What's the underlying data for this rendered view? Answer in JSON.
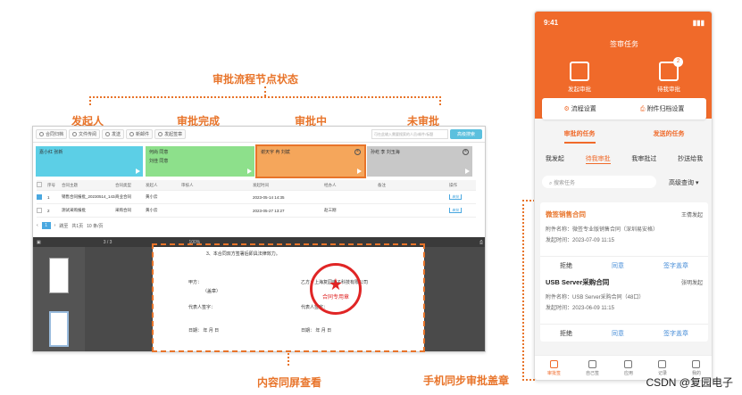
{
  "annotations": {
    "flow_status": "审批流程节点状态",
    "initiator": "发起人",
    "approved": "审批完成",
    "in_progress": "审批中",
    "pending": "未审批",
    "sync_view": "内容同屏查看",
    "mobile_sign": "手机同步审批盖章"
  },
  "toolbar": {
    "items": [
      "合同归档",
      "文件传阅",
      "发送",
      "新邮件",
      "发起签章"
    ],
    "search_placeholder": "可在此输入需要搜索的人员/邮件/标题",
    "search_btn": "高级搜索"
  },
  "flow_cards": [
    {
      "label": "嘉小红 张新",
      "color": "#5ccfe6"
    },
    {
      "label": "何尚 同意",
      "sub": "刘佳 同意",
      "color": "#8de08b"
    },
    {
      "label": "谢天宇 冉 刘斌",
      "color": "#f5a65b"
    },
    {
      "label": "孙屹 李 刘玉海",
      "color": "#c8c8c8"
    }
  ],
  "grid": {
    "headers": [
      "序号",
      "合同主题",
      "合同类型",
      "发起人",
      "审核人",
      "发起时间",
      "经办人",
      "备注",
      "操作"
    ],
    "rows": [
      {
        "no": "1",
        "title": "销售合同报批_20230514_1434",
        "type": "商业合同",
        "by": "黄小云",
        "reviewer": "",
        "time": "2023-05-14 14:35",
        "agent": "",
        "note": "",
        "op": "审批",
        "checked": true
      },
      {
        "no": "2",
        "title": "测试采购报批",
        "type": "采购合同",
        "by": "黄小云",
        "reviewer": "",
        "time": "2023-05-27 13:27",
        "agent": "赵三刚",
        "note": "",
        "op": "审批",
        "checked": false
      }
    ]
  },
  "pager": {
    "total": "共1页",
    "current": "1",
    "size": "10 条/页",
    "goto": "跳至"
  },
  "viewer": {
    "zoom": "100%",
    "page": "3 / 3",
    "line1": "3、本合同双方签署后即具法律效力。",
    "party_a": "甲方：",
    "seal_a": "（盖章）",
    "party_b": "乙方：上海复园电子科技有限公司",
    "rep_a": "代表人签字：",
    "rep_b": "代表人签字：",
    "date_a": "日期：       年      月      日",
    "date_b": "日期：       年      月      日",
    "stamp_text": "合同专用章"
  },
  "phone": {
    "time": "9:41",
    "title": "签审任务",
    "act1": "发起审批",
    "act2": "待我审批",
    "badge": "2",
    "set1": "流程设置",
    "set2": "附件归档设置",
    "tab1": "审批的任务",
    "tab2": "发送的任务",
    "sub": [
      "我发起",
      "待我审批",
      "我审批过",
      "抄送给我"
    ],
    "search": "搜索任务",
    "query": "高级查询",
    "items": [
      {
        "name": "微签销售合同",
        "who": "王倩发起",
        "file": "附件名称：微签专业版销售合同（深圳易安格）",
        "date": "发起时间：2023-07-09 11:15"
      },
      {
        "name": "USB Server采购合同",
        "who": "张明发起",
        "file": "附件名称：USB Server采购合同（48口）",
        "date": "发起时间：2023-06-09 11:15"
      }
    ],
    "actions": [
      "拒绝",
      "同意",
      "签字盖章"
    ],
    "nav": [
      "审批签",
      "自己签",
      "应用",
      "记录",
      "我的"
    ]
  },
  "watermark": "CSDN @复园电子"
}
